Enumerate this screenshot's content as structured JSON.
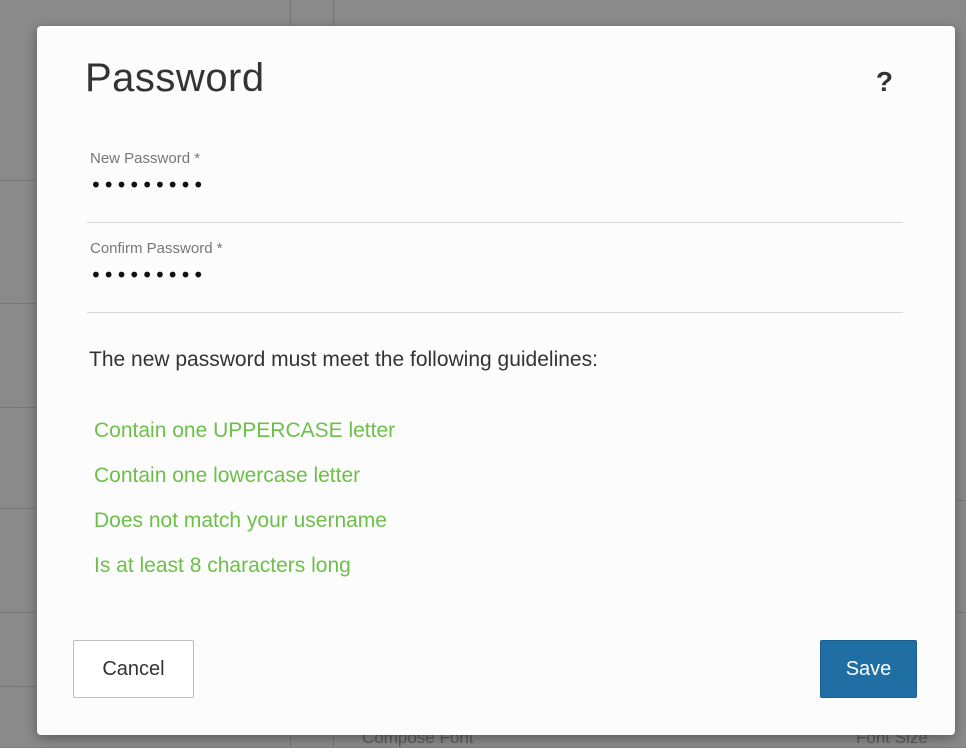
{
  "background": {
    "footer_left": "Compose Font",
    "footer_right": "Font Size"
  },
  "dialog": {
    "title": "Password",
    "help_icon": "?",
    "fields": [
      {
        "label": "New Password *",
        "value": "abcdefghi"
      },
      {
        "label": "Confirm Password *",
        "value": "abcdefghi"
      }
    ],
    "guidelines_intro": "The new password must meet the following guidelines:",
    "rules": [
      "Contain one UPPERCASE letter",
      "Contain one lowercase letter",
      "Does not match your username",
      "Is at least 8 characters long"
    ],
    "rule_color": "#6cbf48",
    "cancel_label": "Cancel",
    "save_label": "Save",
    "save_color": "#1f6fa5"
  }
}
